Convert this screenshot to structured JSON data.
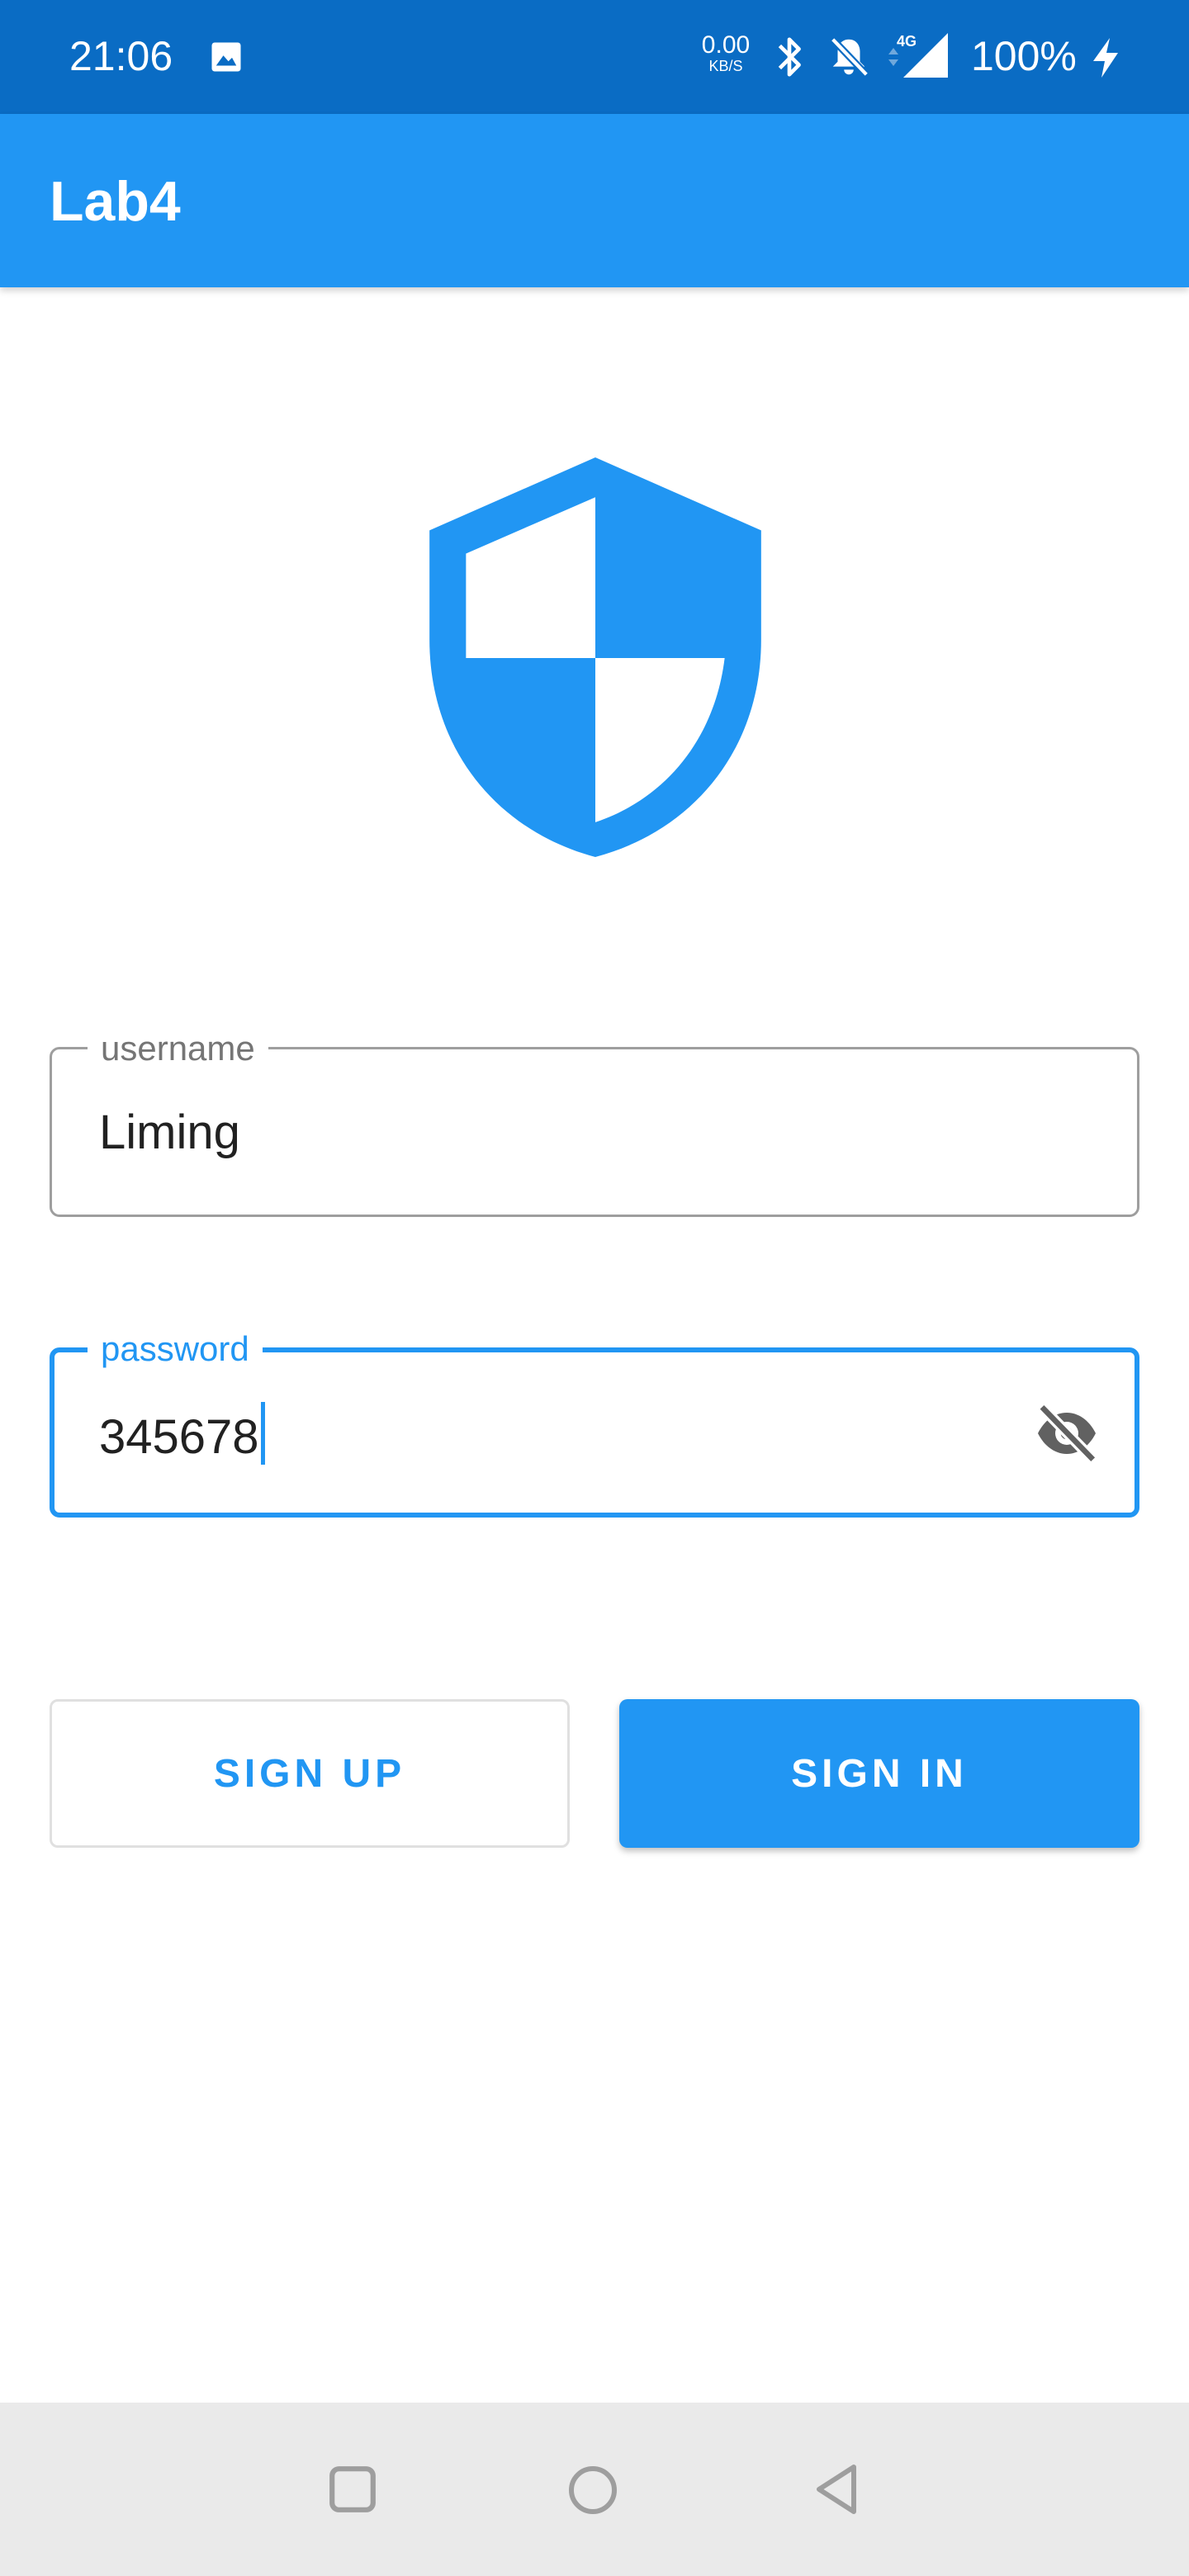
{
  "status_bar": {
    "time": "21:06",
    "net_speed_value": "0.00",
    "net_speed_unit": "KB/S",
    "network_type": "4G",
    "battery": "100%",
    "icons": [
      "photo-icon",
      "bluetooth-icon",
      "notifications-off-icon",
      "signal-icon",
      "charging-icon"
    ]
  },
  "app_bar": {
    "title": "Lab4",
    "color": "#2196F3"
  },
  "logo": {
    "icon": "shield-icon",
    "color": "#2196F3"
  },
  "form": {
    "username": {
      "label": "username",
      "value": "Liming"
    },
    "password": {
      "label": "password",
      "value": "345678",
      "toggle_icon": "visibility-off-icon"
    }
  },
  "buttons": {
    "sign_up": "SIGN UP",
    "sign_in": "SIGN IN"
  },
  "nav_bar": {
    "icons": [
      "recent-apps-icon",
      "home-icon",
      "back-icon"
    ]
  },
  "colors": {
    "primary": "#2196F3",
    "status_bar": "#0A6CC4",
    "nav_bar": "#EAEAEA"
  }
}
